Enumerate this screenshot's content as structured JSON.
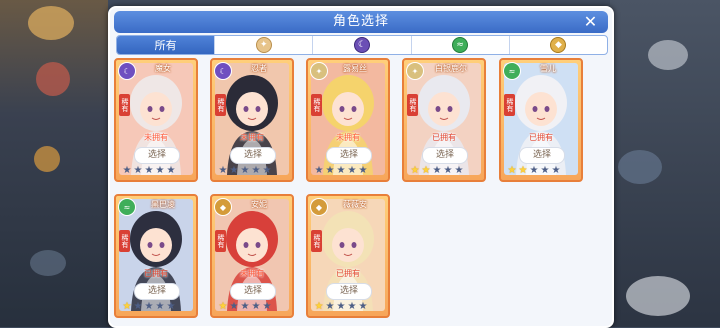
{
  "modal": {
    "title": "角色选择",
    "close_symbol": "✕"
  },
  "tabs": [
    {
      "label": "所有",
      "active": true
    },
    {
      "label": "",
      "icon": "light-element-icon",
      "color": "#e7c48a"
    },
    {
      "label": "",
      "icon": "dark-element-icon",
      "color": "#6b4fb5"
    },
    {
      "label": "",
      "icon": "wind-element-icon",
      "color": "#3fae5a"
    },
    {
      "label": "",
      "icon": "earth-element-icon",
      "color": "#e0b04a"
    }
  ],
  "select_label": "选择",
  "rarity_label": "稀有",
  "characters": [
    {
      "name": "魔女",
      "element": "dark",
      "element_color": "#6f4fc0",
      "owned": "未拥有",
      "stars": 0,
      "hair": "#efe7e6",
      "bg": "#f6c8b8"
    },
    {
      "name": "忍者",
      "element": "dark",
      "element_color": "#6f4fc0",
      "owned": "未拥有",
      "stars": 0,
      "hair": "#2b2b38",
      "bg": "#f1c7ad"
    },
    {
      "name": "露易丝",
      "element": "light",
      "element_color": "#d9c07e",
      "owned": "未拥有",
      "stars": 0,
      "hair": "#f5d36c",
      "bg": "#f3b9a0"
    },
    {
      "name": "白银鹿尔",
      "element": "light",
      "element_color": "#d9c07e",
      "owned": "已拥有",
      "stars": 2,
      "hair": "#e9e9ef",
      "bg": "#f3d2c2"
    },
    {
      "name": "雪儿",
      "element": "wind",
      "element_color": "#3fae5a",
      "owned": "已拥有",
      "stars": 2,
      "hair": "#f1f1f5",
      "bg": "#cfe0f4"
    },
    {
      "name": "黑巴凌",
      "element": "wind",
      "element_color": "#3fae5a",
      "owned": "已拥有",
      "stars": 1,
      "hair": "#2d2f3f",
      "bg": "#c9d4ea"
    },
    {
      "name": "安妮",
      "element": "earth",
      "element_color": "#d49b3a",
      "owned": "未拥有",
      "stars": 1,
      "hair": "#d8403a",
      "bg": "#f1c6b1"
    },
    {
      "name": "薇薇安",
      "element": "earth",
      "element_color": "#d49b3a",
      "owned": "已拥有",
      "stars": 1,
      "hair": "#f3e2b6",
      "bg": "#f6d7b8"
    }
  ]
}
